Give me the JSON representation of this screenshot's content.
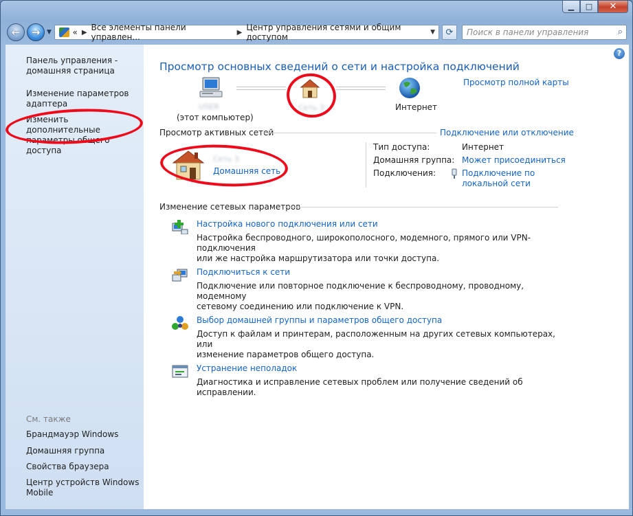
{
  "window": {
    "caption": {
      "minimize": "▁",
      "maximize": "□",
      "close": "✕"
    }
  },
  "nav": {
    "address": {
      "prefix": "«",
      "crumb1": "Все элементы панели управлен...",
      "crumb2": "Центр управления сетями и общим доступом"
    },
    "search_placeholder": "Поиск в панели управления"
  },
  "sidebar": {
    "items": [
      {
        "label": "Панель управления -\nдомашняя страница"
      },
      {
        "label": "Изменение параметров\nадаптера"
      },
      {
        "label": "Изменить дополнительные\nпараметры общего доступа"
      }
    ],
    "see_also": "См. также",
    "see_also_items": [
      {
        "label": "Брандмауэр Windows"
      },
      {
        "label": "Домашняя группа"
      },
      {
        "label": "Свойства браузера"
      },
      {
        "label": "Центр устройств Windows\nMobile"
      }
    ]
  },
  "main": {
    "title": "Просмотр основных сведений о сети и настройка подключений",
    "full_map_link": "Просмотр полной карты",
    "map": {
      "computer_name": "USER",
      "computer_caption": "(этот компьютер)",
      "network_name": "Сеть  3",
      "internet_label": "Интернет"
    },
    "active_networks": {
      "header": "Просмотр активных сетей",
      "connect_link": "Подключение или отключение",
      "network_name": "Сеть  3",
      "network_type_link": "Домашняя сеть",
      "access_type_label": "Тип доступа:",
      "access_type_value": "Интернет",
      "homegroup_label": "Домашняя группа:",
      "homegroup_value": "Может присоединиться",
      "connections_label": "Подключения:",
      "connections_value": "Подключение по\nлокальной сети"
    },
    "change_settings": {
      "header": "Изменение сетевых параметров",
      "tasks": [
        {
          "title": "Настройка нового подключения или сети",
          "desc": "Настройка беспроводного, широкополосного, модемного, прямого или VPN-подключения\nили же настройка маршрутизатора или точки доступа."
        },
        {
          "title": "Подключиться к сети",
          "desc": "Подключение или повторное подключение к беспроводному, проводному, модемному\nсетевому соединению или подключение к VPN."
        },
        {
          "title": "Выбор домашней группы и параметров общего доступа",
          "desc": "Доступ к файлам и принтерам, расположенным на других сетевых компьютерах, или\nизменение параметров общего доступа."
        },
        {
          "title": "Устранение неполадок",
          "desc": "Диагностика и исправление сетевых проблем или получение сведений об исправлении."
        }
      ]
    },
    "help_glyph": "?"
  }
}
